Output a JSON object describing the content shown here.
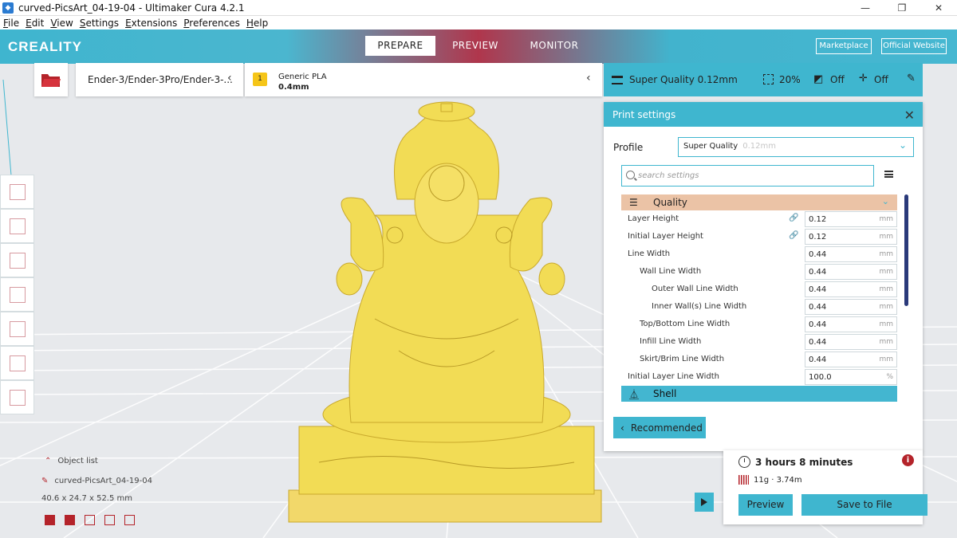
{
  "window": {
    "title": "curved-PicsArt_04-19-04 - Ultimaker Cura 4.2.1",
    "minimize": "—",
    "maximize": "❐",
    "close": "✕"
  },
  "menu": [
    {
      "label": "File",
      "u": "F",
      "rest": "ile"
    },
    {
      "label": "Edit",
      "u": "E",
      "rest": "dit"
    },
    {
      "label": "View",
      "u": "V",
      "rest": "iew"
    },
    {
      "label": "Settings",
      "u": "S",
      "rest": "ettings"
    },
    {
      "label": "Extensions",
      "u": "E",
      "rest": "xtensions"
    },
    {
      "label": "Preferences",
      "u": "P",
      "rest": "references"
    },
    {
      "label": "Help",
      "u": "H",
      "rest": "elp"
    }
  ],
  "header": {
    "logo": "CREALITY",
    "tabs": {
      "prepare": "PREPARE",
      "preview": "PREVIEW",
      "monitor": "MONITOR"
    },
    "marketplace": "Marketplace",
    "official_website": "Official Website"
  },
  "printer": {
    "name": "Ender-3/Ender-3Pro/Ender-3-..."
  },
  "material": {
    "extruder_index": "1",
    "name": "Generic PLA",
    "nozzle": "0.4mm"
  },
  "quality_bar": {
    "profile": "Super Quality 0.12mm",
    "infill": "20%",
    "support": "Off",
    "adhesion": "Off"
  },
  "print_settings": {
    "title": "Print settings",
    "profile_label": "Profile",
    "profile_value": "Super Quality",
    "profile_sub": "0.12mm",
    "search_placeholder": "search settings",
    "categories": {
      "quality": "Quality",
      "shell": "Shell"
    },
    "rows": [
      {
        "label": "Layer Height",
        "value": "0.12",
        "unit": "mm",
        "linked": true
      },
      {
        "label": "Initial Layer Height",
        "value": "0.12",
        "unit": "mm",
        "linked": true
      },
      {
        "label": "Line Width",
        "value": "0.44",
        "unit": "mm"
      },
      {
        "label": "Wall Line Width",
        "value": "0.44",
        "unit": "mm"
      },
      {
        "label": "Outer Wall Line Width",
        "value": "0.44",
        "unit": "mm"
      },
      {
        "label": "Inner Wall(s) Line Width",
        "value": "0.44",
        "unit": "mm"
      },
      {
        "label": "Top/Bottom Line Width",
        "value": "0.44",
        "unit": "mm"
      },
      {
        "label": "Infill Line Width",
        "value": "0.44",
        "unit": "mm"
      },
      {
        "label": "Skirt/Brim Line Width",
        "value": "0.44",
        "unit": "mm"
      },
      {
        "label": "Initial Layer Line Width",
        "value": "100.0",
        "unit": "%"
      }
    ],
    "recommended_label": "Recommended"
  },
  "output": {
    "time": "3 hours 8 minutes",
    "material": "11g · 3.74m",
    "preview_label": "Preview",
    "save_label": "Save to File",
    "info": "i"
  },
  "object": {
    "list_label": "Object list",
    "name": "curved-PicsArt_04-19-04",
    "dimensions": "40.6 x 24.7 x 52.5 mm"
  },
  "colors": {
    "accent": "#3fb6cf",
    "header_red": "#b0364c",
    "quality_cat": "#ebc3a6",
    "model": "#f2dc55"
  }
}
